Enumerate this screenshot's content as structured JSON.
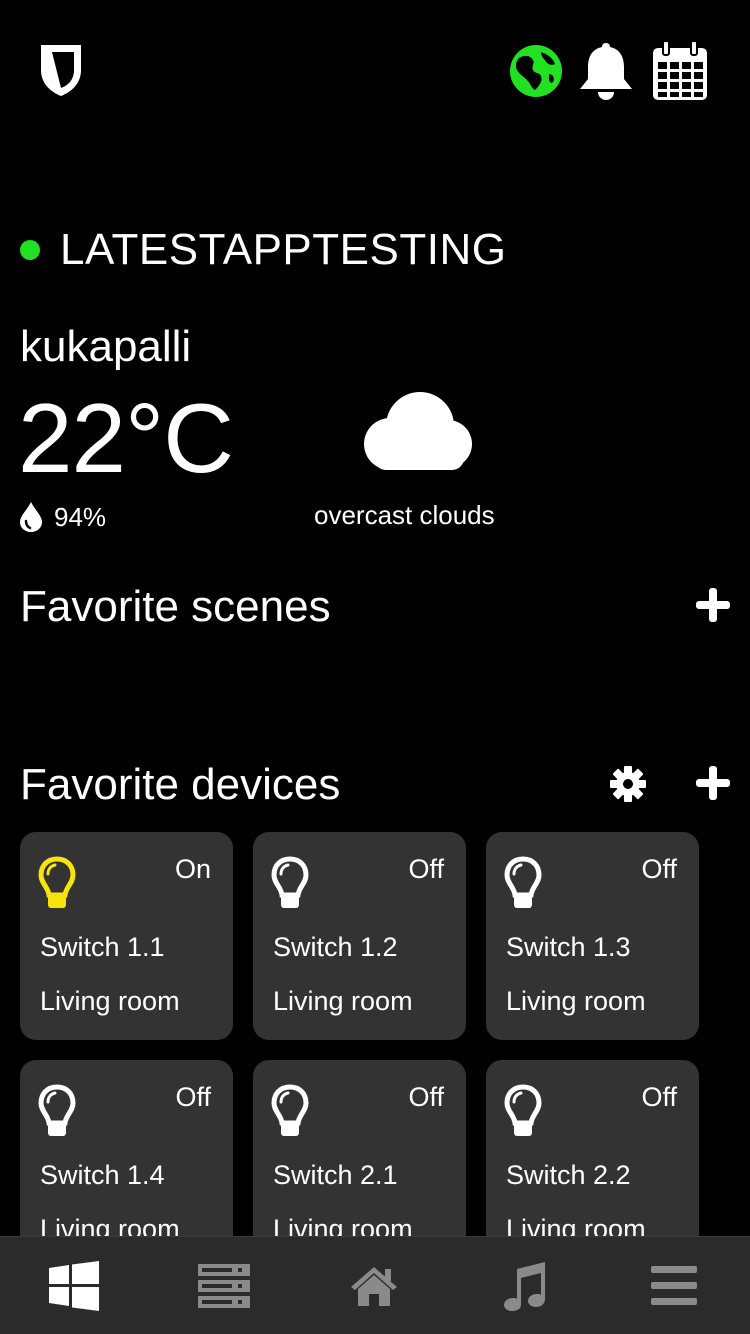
{
  "header": {
    "logo_icon": "shield-logo-icon",
    "icons": [
      "globe-icon",
      "bell-icon",
      "calendar-icon"
    ],
    "globe_color": "#22e022"
  },
  "home": {
    "name": "LATESTAPPTESTING",
    "status_color": "#22e022"
  },
  "weather": {
    "location": "kukapalli",
    "temperature": "22°C",
    "humidity": "94%",
    "description": "overcast clouds",
    "icon": "cloud-icon"
  },
  "scenes": {
    "title": "Favorite scenes"
  },
  "devices": {
    "title": "Favorite devices",
    "on_color": "#f5e50a",
    "items": [
      {
        "name": "Switch 1.1",
        "room": "Living room",
        "state": "On"
      },
      {
        "name": "Switch 1.2",
        "room": "Living room",
        "state": "Off"
      },
      {
        "name": "Switch 1.3",
        "room": "Living room",
        "state": "Off"
      },
      {
        "name": "Switch 1.4",
        "room": "Living room",
        "state": "Off"
      },
      {
        "name": "Switch 2.1",
        "room": "Living room",
        "state": "Off"
      },
      {
        "name": "Switch 2.2",
        "room": "Living room",
        "state": "Off"
      }
    ]
  },
  "tabbar": {
    "tabs": [
      "windows-icon",
      "server-rack-icon",
      "home-icon",
      "music-icon",
      "menu-icon"
    ],
    "active": 0
  }
}
